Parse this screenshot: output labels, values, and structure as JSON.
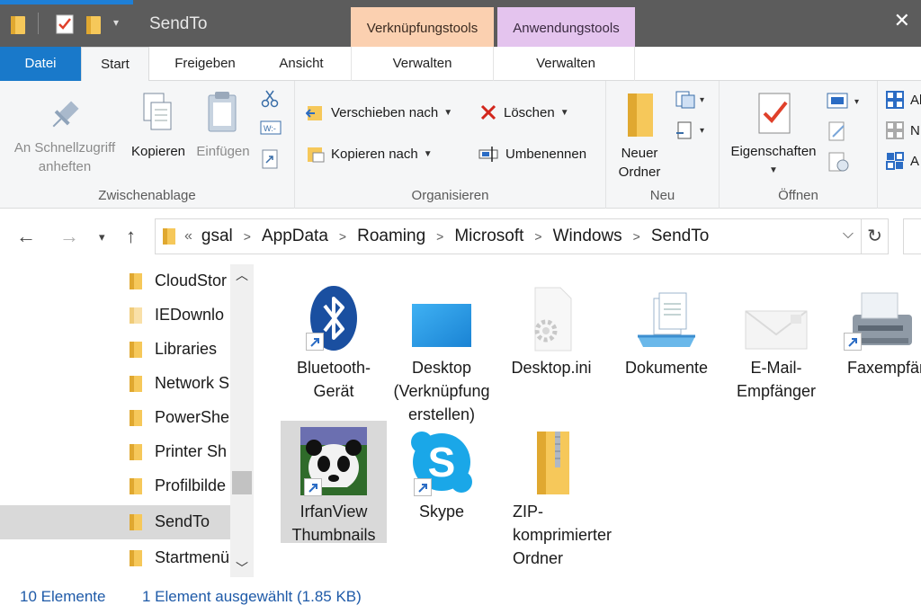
{
  "window": {
    "title": "SendTo",
    "context_tabs": {
      "verknuepfungstools": "Verknüpfungstools",
      "anwendungstools": "Anwendungstools"
    },
    "close_glyph": "✕"
  },
  "ribbon_tabs": {
    "datei": "Datei",
    "start": "Start",
    "freigeben": "Freigeben",
    "ansicht": "Ansicht",
    "verwalten1": "Verwalten",
    "verwalten2": "Verwalten"
  },
  "ribbon": {
    "zwischenablage": {
      "label": "Zwischenablage",
      "pin_line1": "An Schnellzugriff",
      "pin_line2": "anheften",
      "kopieren": "Kopieren",
      "einfuegen": "Einfügen"
    },
    "organisieren": {
      "label": "Organisieren",
      "verschieben": "Verschieben nach",
      "kopieren_nach": "Kopieren nach",
      "loeschen": "Löschen",
      "umbenennen": "Umbenennen"
    },
    "neu": {
      "label": "Neu",
      "ordner_line1": "Neuer",
      "ordner_line2": "Ordner"
    },
    "oeffnen": {
      "label": "Öffnen",
      "eigenschaften": "Eigenschaften"
    },
    "auswaehlen": {
      "a1": "Al",
      "a2": "N",
      "a3": "A"
    }
  },
  "address": {
    "prefix": "«",
    "crumbs": [
      "gsal",
      "AppData",
      "Roaming",
      "Microsoft",
      "Windows",
      "SendTo"
    ]
  },
  "nav_items": [
    "CloudStor",
    "IEDownlo",
    "Libraries",
    "Network S",
    "PowerShe",
    "Printer Sh",
    "Profilbilde",
    "SendTo",
    "Startmenü"
  ],
  "files": {
    "bluetooth": "Bluetooth-Gerät",
    "desktop": "Desktop (Verknüpfung erstellen)",
    "desktop_ini": "Desktop.ini",
    "dokumente": "Dokumente",
    "email": "E-Mail-Empfänger",
    "fax": "Faxempfänger",
    "irfanview": "IrfanView Thumbnails",
    "skype": "Skype",
    "zip": "ZIP-komprimierter Ordner"
  },
  "status": {
    "count": "10 Elemente",
    "selection": "1 Element ausgewählt (1.85 KB)"
  },
  "colors": {
    "accent": "#1979ca",
    "verknuepfungstools": "#fbd0b0",
    "anwendungstools": "#e4c4ee",
    "folder": "#f6c85a",
    "status_text": "#1e5aa8"
  }
}
